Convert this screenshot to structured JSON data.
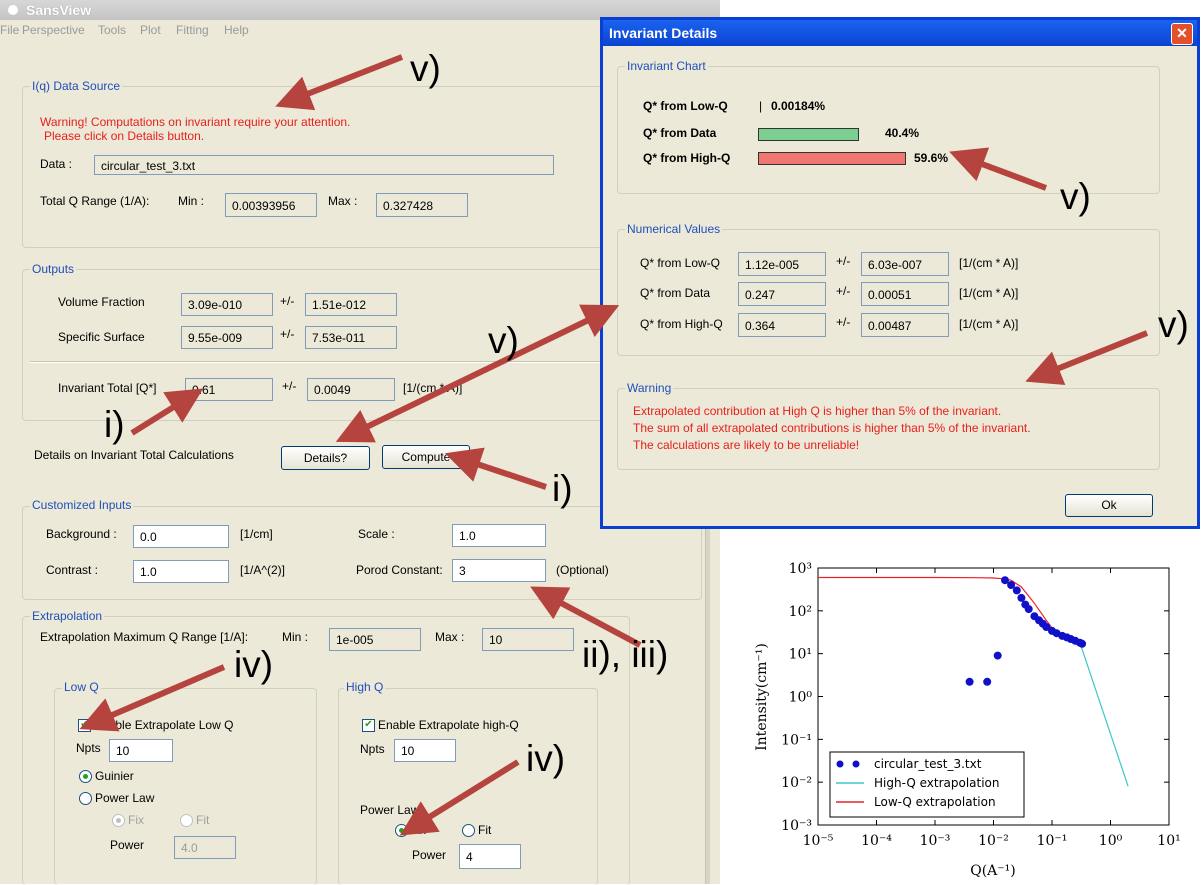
{
  "app": {
    "title": "SansView",
    "menu": [
      "File",
      "Perspective",
      "Tools",
      "Plot",
      "Fitting",
      "Help"
    ]
  },
  "data_source": {
    "group_label": "I(q) Data Source",
    "warning_line1": "Warning! Computations on invariant require your attention.",
    "warning_line2": "Please click on Details button.",
    "data_label": "Data :",
    "data_value": "circular_test_3.txt",
    "q_range_label": "Total Q Range (1/A):",
    "min_label": "Min :",
    "min_value": "0.00393956",
    "max_label": "Max :",
    "max_value": "0.327428"
  },
  "outputs": {
    "group_label": "Outputs",
    "volume_fraction_label": "Volume Fraction",
    "volume_fraction_value": "3.09e-010",
    "volume_fraction_err": "1.51e-012",
    "specific_surface_label": "Specific Surface",
    "specific_surface_value": "9.55e-009",
    "specific_surface_err": "7.53e-011",
    "pm": "+/-",
    "invariant_total_label": "Invariant Total [Q*]",
    "invariant_total_value": "0.61",
    "invariant_total_err": "0.0049",
    "invariant_unit": "[1/(cm * A)]"
  },
  "details_row": {
    "label": "Details on Invariant Total Calculations",
    "details_button": "Details?",
    "compute_button": "Compute"
  },
  "custom_inputs": {
    "group_label": "Customized Inputs",
    "background_label": "Background :",
    "background_value": "0.0",
    "background_unit": "[1/cm]",
    "scale_label": "Scale :",
    "scale_value": "1.0",
    "contrast_label": "Contrast :",
    "contrast_value": "1.0",
    "contrast_unit": "[1/A^(2)]",
    "porod_label": "Porod Constant:",
    "porod_value": "3",
    "optional_label": "(Optional)"
  },
  "extrapolation": {
    "group_label": "Extrapolation",
    "range_label": "Extrapolation Maximum Q Range [1/A]:",
    "min_label": "Min :",
    "min_value": "1e-005",
    "max_label": "Max :",
    "max_value": "10",
    "low_q": {
      "group_label": "Low Q",
      "enable_label": "Enable Extrapolate Low Q",
      "enabled": true,
      "npts_label": "Npts",
      "npts_value": "10",
      "guinier_label": "Guinier",
      "power_law_label": "Power Law",
      "selected": "Guinier",
      "fix_label": "Fix",
      "fit_label": "Fit",
      "power_label": "Power",
      "power_value": "4.0"
    },
    "high_q": {
      "group_label": "High Q",
      "enable_label": "Enable Extrapolate high-Q",
      "enabled": true,
      "npts_label": "Npts",
      "npts_value": "10",
      "power_law_label": "Power Law",
      "fix_label": "Fix",
      "fit_label": "Fit",
      "selected": "Fix",
      "power_label": "Power",
      "power_value": "4"
    }
  },
  "dialog": {
    "title": "Invariant Details",
    "close": "✕",
    "chart_group": "Invariant Chart",
    "chart_rows": [
      {
        "label": "Q* from Low-Q",
        "separator": "|",
        "percent": "0.00184%",
        "fraction": 1.84e-05,
        "color": "#ffffff"
      },
      {
        "label": "Q* from Data",
        "percent": "40.4%",
        "fraction": 0.404,
        "color": "#7ccf90"
      },
      {
        "label": "Q* from High-Q",
        "percent": "59.6%",
        "fraction": 0.596,
        "color": "#f07670"
      }
    ],
    "numerical_group": "Numerical Values",
    "numerical_rows": [
      {
        "label": "Q* from Low-Q",
        "value": "1.12e-005",
        "pm": "+/-",
        "err": "6.03e-007",
        "unit": "[1/(cm * A)]"
      },
      {
        "label": "Q* from Data",
        "value": "0.247",
        "pm": "+/-",
        "err": "0.00051",
        "unit": "[1/(cm * A)]"
      },
      {
        "label": "Q* from High-Q",
        "value": "0.364",
        "pm": "+/-",
        "err": "0.00487",
        "unit": "[1/(cm * A)]"
      }
    ],
    "warning_group": "Warning",
    "warning_lines": [
      "Extrapolated contribution at High Q is higher than 5% of the invariant.",
      "The sum of all extrapolated contributions is higher than 5% of the invariant.",
      "The calculations are likely to be unreliable!"
    ],
    "ok_button": "Ok"
  },
  "plot": {
    "ylabel": "Intensity(cm⁻¹)",
    "xlabel": "Q(A⁻¹)",
    "xticks": [
      "10⁻⁵",
      "10⁻⁴",
      "10⁻³",
      "10⁻²",
      "10⁻¹",
      "10⁰",
      "10¹"
    ],
    "yticks": [
      "10³",
      "10²",
      "10¹",
      "10⁰",
      "10⁻¹",
      "10⁻²",
      "10⁻³"
    ],
    "legend": [
      "circular_test_3.txt",
      "High-Q extrapolation",
      "Low-Q extrapolation"
    ],
    "colors": {
      "data": "#1010c8",
      "high": "#3ec6c6",
      "low": "#e8222a"
    }
  },
  "chart_data": {
    "type": "scatter",
    "xlabel": "Q(A⁻¹)",
    "ylabel": "Intensity(cm⁻¹)",
    "xscale": "log",
    "yscale": "log",
    "xlim": [
      1e-05,
      10
    ],
    "ylim": [
      0.001,
      1000
    ],
    "legend_position": "bottom-left",
    "series": [
      {
        "name": "circular_test_3.txt",
        "kind": "points",
        "x": [
          0.0039,
          0.0078,
          0.0118,
          0.0157,
          0.02,
          0.025,
          0.03,
          0.035,
          0.04,
          0.05,
          0.06,
          0.07,
          0.08,
          0.1,
          0.12,
          0.15,
          0.18,
          0.21,
          0.25,
          0.3,
          0.327
        ],
        "y": [
          2.2,
          2.2,
          9,
          520,
          400,
          300,
          200,
          140,
          110,
          75,
          60,
          50,
          42,
          34,
          30,
          26,
          24,
          22,
          20,
          18,
          17
        ]
      },
      {
        "name": "High-Q extrapolation",
        "kind": "line",
        "x": [
          0.3,
          2.0
        ],
        "y": [
          18,
          0.008
        ]
      },
      {
        "name": "Low-Q extrapolation",
        "kind": "line",
        "x": [
          1e-05,
          0.001,
          0.005,
          0.01,
          0.015,
          0.02,
          0.03,
          0.05,
          0.08,
          0.1
        ],
        "y": [
          600,
          600,
          595,
          585,
          560,
          520,
          360,
          150,
          60,
          40
        ]
      }
    ]
  },
  "annotations": {
    "v_top": "v)",
    "v_dialog_chart": "v)",
    "v_dialog_right": "v)",
    "v_middle": "v)",
    "i_left": "i)",
    "i_right": "i)",
    "ii_iii": "ii), iii)",
    "iv_left": "iv)",
    "iv_right": "iv)"
  }
}
